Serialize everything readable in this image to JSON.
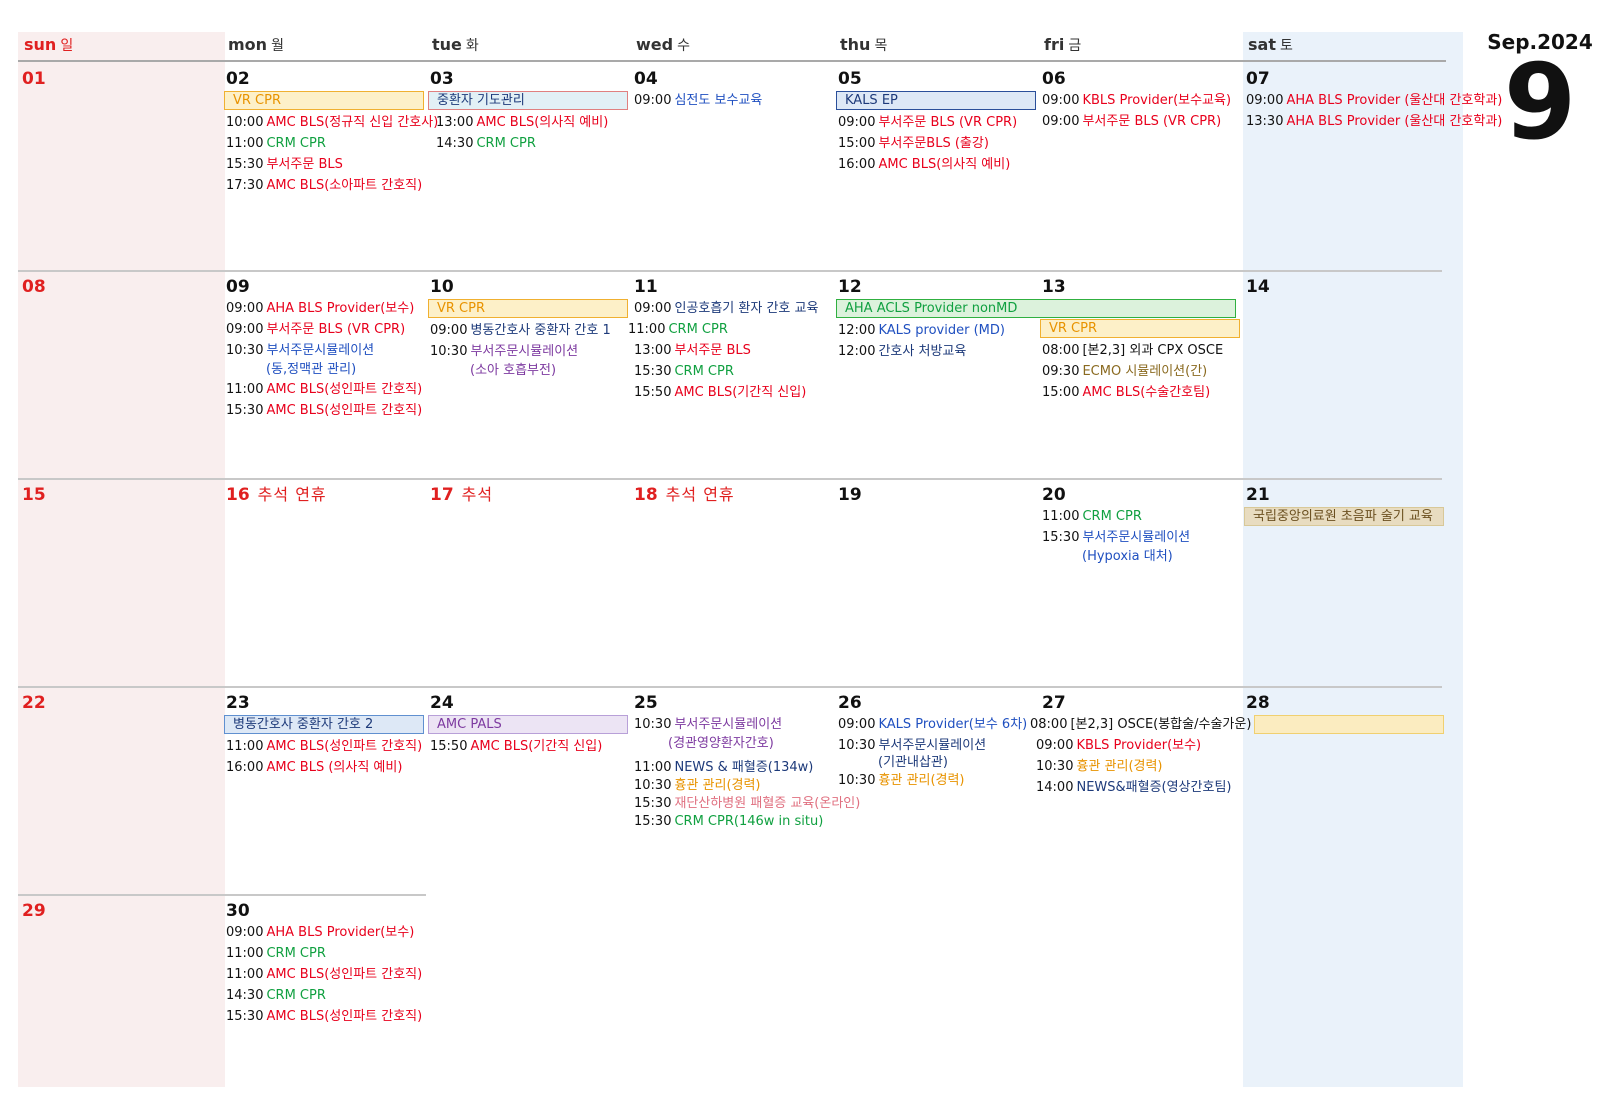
{
  "month_label": "Sep.2024",
  "month_number": "9",
  "colors": {
    "red": "#e8001c",
    "green": "#10a040",
    "blue": "#2050c0",
    "navy": "#1d3a7a",
    "purple": "#7d3aa0",
    "orange": "#e89300",
    "brown": "#8a6a20",
    "pink": "#e07080",
    "sunday_bg": "#f9eeee",
    "saturday_bg": "#eaf2fa"
  },
  "headers": [
    {
      "en": "sun",
      "ko": "일"
    },
    {
      "en": "mon",
      "ko": "월"
    },
    {
      "en": "tue",
      "ko": "화"
    },
    {
      "en": "wed",
      "ko": "수"
    },
    {
      "en": "thu",
      "ko": "목"
    },
    {
      "en": "fri",
      "ko": "금"
    },
    {
      "en": "sat",
      "ko": "토"
    }
  ],
  "days": {
    "d01": "01",
    "d02": "02",
    "d03": "03",
    "d04": "04",
    "d05": "05",
    "d06": "06",
    "d07": "07",
    "d08": "08",
    "d09": "09",
    "d10": "10",
    "d11": "11",
    "d12": "12",
    "d13": "13",
    "d14": "14",
    "d15": "15",
    "d16": "16",
    "d17": "17",
    "d18": "18",
    "d19": "19",
    "d20": "20",
    "d21": "21",
    "d22": "22",
    "d23": "23",
    "d24": "24",
    "d25": "25",
    "d26": "26",
    "d27": "27",
    "d28": "28",
    "d29": "29",
    "d30": "30"
  },
  "holidays": {
    "h16": "추석 연휴",
    "h17": "추석",
    "h18": "추석 연휴"
  },
  "bars": {
    "b02": "VR CPR",
    "b03": "중환자 기도관리",
    "b05": "KALS EP",
    "b10": "VR CPR",
    "b12": "AHA ACLS Provider  nonMD",
    "b13": "VR CPR",
    "b21": "국립중앙의료원 초음파 술기 교육",
    "b23": "병동간호사 중환자 간호 2",
    "b24": "AMC PALS",
    "b28": ""
  },
  "events": {
    "e02": [
      {
        "t": "10:00",
        "n": "AMC BLS(정규직 신입 간호사)"
      },
      {
        "t": "11:00",
        "n": "CRM CPR"
      },
      {
        "t": "15:30",
        "n": "부서주문 BLS"
      },
      {
        "t": "17:30",
        "n": "AMC BLS(소아파트 간호직)"
      }
    ],
    "e03": [
      {
        "t": "13:00",
        "n": "AMC BLS(의사직 예비)"
      },
      {
        "t": "14:30",
        "n": "CRM CPR"
      }
    ],
    "e04": [
      {
        "t": "09:00",
        "n": "심전도 보수교육"
      }
    ],
    "e05": [
      {
        "t": "09:00",
        "n": "부서주문 BLS (VR CPR)"
      },
      {
        "t": "15:00",
        "n": "부서주문BLS (출강)"
      },
      {
        "t": "16:00",
        "n": "AMC BLS(의사직 예비)"
      }
    ],
    "e06": [
      {
        "t": "09:00",
        "n": "KBLS Provider(보수교육)"
      },
      {
        "t": "09:00",
        "n": "부서주문 BLS (VR CPR)"
      }
    ],
    "e07": [
      {
        "t": "09:00",
        "n": "AHA BLS Provider (울산대 간호학과)"
      },
      {
        "t": "13:30",
        "n": "AHA BLS Provider (울산대 간호학과)"
      }
    ],
    "e09": [
      {
        "t": "09:00",
        "n": "AHA BLS Provider(보수)"
      },
      {
        "t": "09:00",
        "n": "부서주문 BLS (VR CPR)"
      },
      {
        "t": "10:30",
        "n": "부서주문시뮬레이션",
        "c": "(동,정맥관 관리)"
      },
      {
        "t": "11:00",
        "n": "AMC BLS(성인파트 간호직)"
      },
      {
        "t": "15:30",
        "n": "AMC BLS(성인파트 간호직)"
      }
    ],
    "e10": [
      {
        "t": "09:00",
        "n": "병동간호사 중환자 간호 1"
      },
      {
        "t": "10:30",
        "n": "부서주문시뮬레이션",
        "c": "(소아 호흡부전)"
      }
    ],
    "e11": [
      {
        "t": "09:00",
        "n": "인공호흡기 환자 간호 교육"
      },
      {
        "t": "11:00",
        "n": "CRM CPR"
      },
      {
        "t": "13:00",
        "n": "부서주문 BLS"
      },
      {
        "t": "15:30",
        "n": "CRM CPR"
      },
      {
        "t": "15:50",
        "n": "AMC BLS(기간직 신입)"
      }
    ],
    "e12": [
      {
        "t": "12:00",
        "n": "KALS provider (MD)"
      },
      {
        "t": "12:00",
        "n": "간호사 처방교육"
      }
    ],
    "e13": [
      {
        "t": "08:00",
        "n": "[본2,3] 외과 CPX OSCE"
      },
      {
        "t": "09:30",
        "n": "ECMO 시뮬레이션(간)"
      },
      {
        "t": "15:00",
        "n": "AMC BLS(수술간호팀)"
      }
    ],
    "e20": [
      {
        "t": "11:00",
        "n": "CRM CPR"
      },
      {
        "t": "15:30",
        "n": "부서주문시뮬레이션",
        "c": "(Hypoxia 대처)"
      }
    ],
    "e23": [
      {
        "t": "11:00",
        "n": "AMC BLS(성인파트 간호직)"
      },
      {
        "t": "16:00",
        "n": "AMC BLS (의사직 예비)"
      }
    ],
    "e24": [
      {
        "t": "15:50",
        "n": "AMC BLS(기간직 신입)"
      }
    ],
    "e25": [
      {
        "t": "10:30",
        "n": "부서주문시뮬레이션",
        "c": "(경관영양환자간호)"
      },
      {
        "t": "11:00",
        "n": "NEWS & 패혈증(134w)"
      },
      {
        "t": "10:30",
        "n": "흉관 관리(경력)"
      },
      {
        "t": "15:30",
        "n": "재단산하병원 패혈증 교육(온라인)"
      },
      {
        "t": "15:30",
        "n": "CRM CPR(146w in situ)"
      }
    ],
    "e26": [
      {
        "t": "09:00",
        "n": "KALS Provider(보수 6차)"
      },
      {
        "t": "10:30",
        "n": "부서주문시뮬레이션",
        "c": "(기관내삽관)"
      },
      {
        "t": "10:30",
        "n": "흉관 관리(경력)"
      }
    ],
    "e27": [
      {
        "t": "08:00",
        "n": "[본2,3] OSCE(봉합술/수술가운)"
      },
      {
        "t": "09:00",
        "n": "KBLS Provider(보수)"
      },
      {
        "t": "10:30",
        "n": "흉관 관리(경력)"
      },
      {
        "t": "14:00",
        "n": "NEWS&패혈증(영상간호팀)"
      }
    ],
    "e30": [
      {
        "t": "09:00",
        "n": "AHA BLS Provider(보수)"
      },
      {
        "t": "11:00",
        "n": "CRM CPR"
      },
      {
        "t": "11:00",
        "n": "AMC BLS(성인파트 간호직)"
      },
      {
        "t": "14:30",
        "n": "CRM CPR"
      },
      {
        "t": "15:30",
        "n": "AMC BLS(성인파트 간호직)"
      }
    ]
  }
}
